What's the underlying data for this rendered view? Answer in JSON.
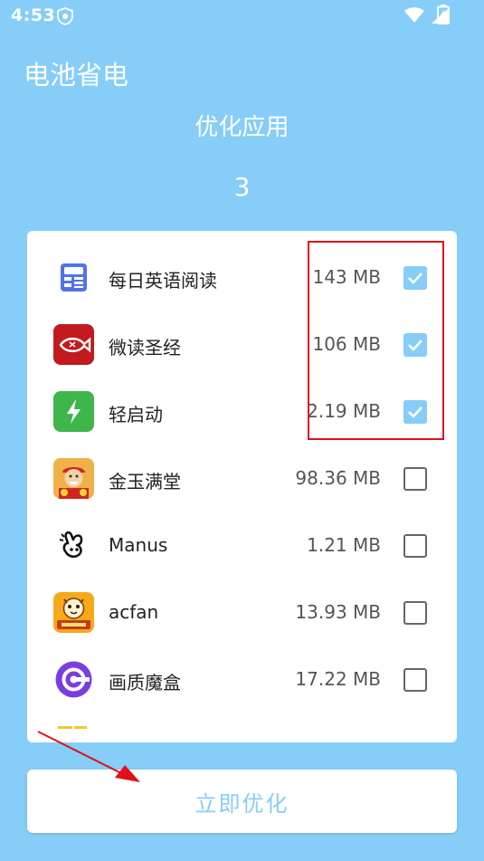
{
  "status_bar": {
    "time": "4:53",
    "icons": [
      "shield-icon",
      "wifi-icon",
      "signal-icon",
      "battery-charging-icon"
    ]
  },
  "app_title": "电池省电",
  "section_title": "优化应用",
  "selected_count": "3",
  "apps": [
    {
      "name": "每日英语阅读",
      "size": "143 MB",
      "checked": true,
      "icon": "calculator-icon"
    },
    {
      "name": "微读圣经",
      "size": "106 MB",
      "checked": true,
      "icon": "fish-icon"
    },
    {
      "name": "轻启动",
      "size": "2.19 MB",
      "checked": true,
      "icon": "lightning-icon"
    },
    {
      "name": "金玉满堂",
      "size": "98.36 MB",
      "checked": false,
      "icon": "fortune-god-icon"
    },
    {
      "name": "Manus",
      "size": "1.21 MB",
      "checked": false,
      "icon": "hand-icon"
    },
    {
      "name": "acfan",
      "size": "13.93 MB",
      "checked": false,
      "icon": "tiger-icon"
    },
    {
      "name": "画质魔盒",
      "size": "17.22 MB",
      "checked": false,
      "icon": "camera-ring-icon"
    }
  ],
  "optimize_button": "立即优化",
  "colors": {
    "background": "#86cdf8",
    "accent": "#86cdf8",
    "annotation": "#e10f1a"
  }
}
